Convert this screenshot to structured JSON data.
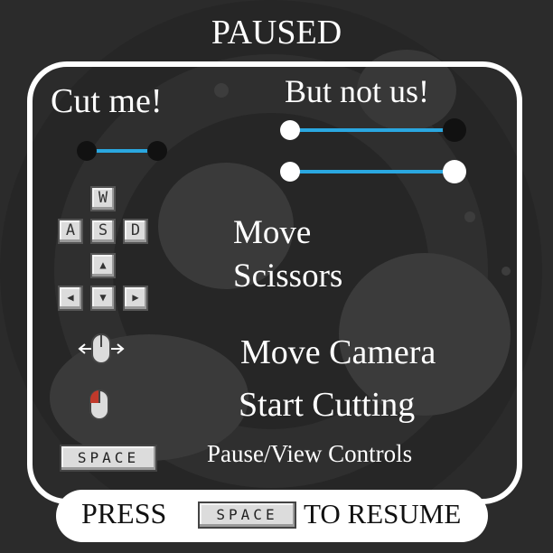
{
  "title": "PAUSED",
  "cut_label": "Cut me!",
  "not_cut_label": "But not us!",
  "controls": [
    {
      "label": "Move\nScissors"
    },
    {
      "label": "Move Camera"
    },
    {
      "label": "Start Cutting"
    },
    {
      "label": "Pause/View Controls"
    }
  ],
  "keys": {
    "w": "W",
    "a": "A",
    "s": "S",
    "d": "D",
    "up": "▲",
    "left": "◀",
    "down": "▼",
    "right": "▶",
    "space": "SPACE"
  },
  "resume": {
    "press": "PRESS",
    "key": "SPACE",
    "to_resume": "TO RESUME"
  },
  "colors": {
    "line": "#2aa7e0",
    "panel_border": "#ffffff",
    "background": "#2a2a2a",
    "mouse_click": "#c0392b"
  }
}
